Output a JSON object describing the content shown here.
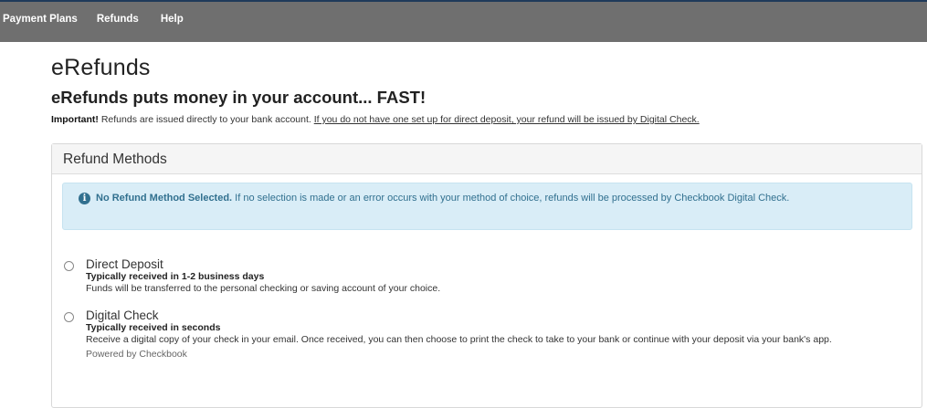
{
  "nav": {
    "items": [
      {
        "label": "Payment Plans"
      },
      {
        "label": "Refunds"
      },
      {
        "label": "Help"
      }
    ]
  },
  "page": {
    "title": "eRefunds",
    "subtitle": "eRefunds puts money in your account... FAST!",
    "important_label": "Important!",
    "important_text": " Refunds are issued directly to your bank account. ",
    "important_note": "If you do not have one set up for direct deposit, your refund will be issued by Digital Check."
  },
  "panel": {
    "heading": "Refund Methods",
    "alert": {
      "icon": "info-icon",
      "strong": "No Refund Method Selected.",
      "text": " If no selection is made or an error occurs with your method of choice, refunds will be processed by Checkbook Digital Check."
    },
    "options": [
      {
        "title": "Direct Deposit",
        "speed": "Typically received in 1-2 business days",
        "description": "Funds will be transferred to the personal checking or saving account of your choice.",
        "selected": false
      },
      {
        "title": "Digital Check",
        "speed": "Typically received in seconds",
        "description": "Receive a digital copy of your check in your email. Once received, you can then choose to print the check to take to your bank or continue with your deposit via your bank's app.",
        "powered_by": "Powered by Checkbook",
        "selected": false
      }
    ]
  },
  "colors": {
    "topbar": "#6f6f6f",
    "topbar_border": "#1f3a5a",
    "alert_bg": "#d9edf7",
    "alert_text": "#31708f"
  }
}
